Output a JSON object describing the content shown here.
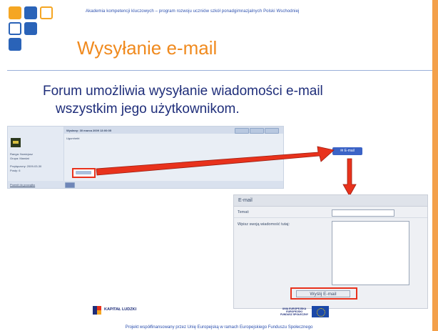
{
  "header": {
    "top_text": "Akademia kompetencji kluczowych – program rozwoju uczniów szkół ponadgimnazjalnych Polski Wschodniej",
    "title": "Wysyłanie e-mail"
  },
  "body": {
    "line1": "Forum umożliwia wysyłanie wiadomości e-mail",
    "line2": "wszystkim jego użytkownikom."
  },
  "forum_screenshot": {
    "sent_label": "Wysłany: 30 marca 2009 13:00:05",
    "greeting": "Ugumhebt",
    "rank_label": "Ranga: Nowicjusz",
    "group_label": "Grupa: Mandat",
    "joined_label": "Przyłączony: 2009-03-30",
    "posts_label": "Posty: 6",
    "back_link": "Powrót do początku",
    "email_button": "E-mail"
  },
  "email_form": {
    "heading": "E-mail",
    "subject_label": "Temat:",
    "message_label": "Wpisz swoją wiadomość tutaj:",
    "send_button": "Wyślij E-mail"
  },
  "logos": {
    "kapital": "KAPITAŁ LUDZKI",
    "ue_line1": "UNIA EUROPEJSKA",
    "ue_line2": "EUROPEJSKI",
    "ue_line3": "FUNDUSZ SPOŁECZNY"
  },
  "footer": {
    "text": "Projekt współfinansowany przez Unię Europejską w ramach Europejskiego Funduszu Społecznego"
  },
  "colors": {
    "title": "#f08a1e",
    "text": "#1f2e7a",
    "accent_blue": "#2b4fae",
    "highlight": "#e8321c",
    "stripe": "#f3a04a"
  }
}
